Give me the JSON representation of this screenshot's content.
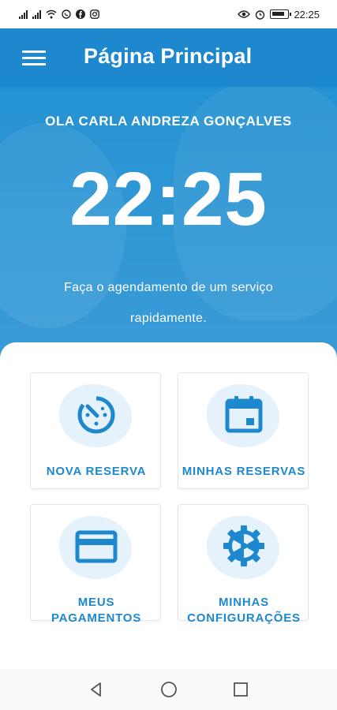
{
  "status_bar": {
    "time": "22:25",
    "left_icons": [
      "signal-icon",
      "signal-icon",
      "wifi-icon",
      "whatsapp-icon",
      "facebook-icon",
      "instagram-icon"
    ],
    "right_icons": [
      "eye-icon",
      "alarm-icon",
      "battery-icon"
    ]
  },
  "app_bar": {
    "title": "Página Principal",
    "menu_icon": "hamburger-menu-icon"
  },
  "hero": {
    "greeting": "OLA CARLA ANDREZA GONÇALVES",
    "clock": "22:25",
    "subtitle": "Faça o agendamento de um serviço rapidamente."
  },
  "menu": {
    "items": [
      {
        "label": "NOVA RESERVA",
        "icon": "timer-icon"
      },
      {
        "label": "MINHAS RESERVAS",
        "icon": "calendar-icon"
      },
      {
        "label": "MEUS PAGAMENTOS",
        "label_line1": "MEUS",
        "label_line2": "PAGAMENTOS",
        "icon": "credit-card-icon"
      },
      {
        "label": "MINHAS CONFIGURAÇÕES",
        "label_line1": "MINHAS",
        "label_line2": "CONFIGURAÇÕES",
        "icon": "gear-icon"
      }
    ]
  },
  "nav_bar": {
    "buttons": [
      "back-icon",
      "home-icon",
      "recents-icon"
    ]
  },
  "colors": {
    "primary": "#1e88ce",
    "hero": "#2b95d4",
    "icon_blob": "#e6f2fb"
  }
}
